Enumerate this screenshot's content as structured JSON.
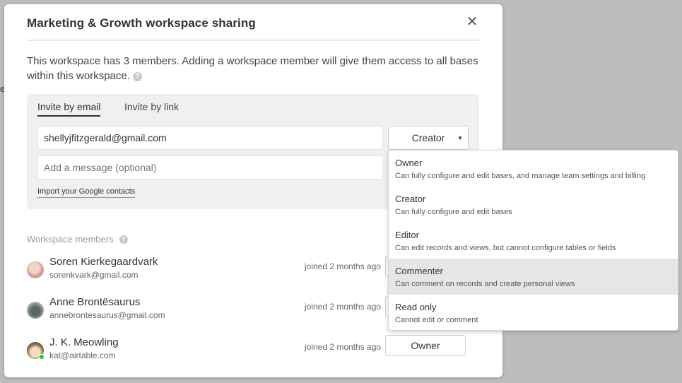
{
  "background_fragment": "es",
  "modal": {
    "title": "Marketing & Growth workspace sharing",
    "close_glyph": "✕",
    "description": "This workspace has 3 members. Adding a workspace member will give them access to all bases within this workspace.",
    "help_glyph": "?"
  },
  "invite": {
    "tabs": [
      {
        "label": "Invite by email",
        "active": true
      },
      {
        "label": "Invite by link",
        "active": false
      }
    ],
    "email_value": "shellyjfitzgerald@gmail.com",
    "message_placeholder": "Add a message (optional)",
    "selected_role": "Creator",
    "caret_glyph": "▼",
    "import_label": "Import your Google contacts"
  },
  "members_section": {
    "heading": "Workspace members",
    "members": [
      {
        "name": "Soren Kierkegaardvark",
        "email": "sorenkvark@gmail.com",
        "joined": "joined 2 months ago",
        "role": "",
        "online": false,
        "avatar_color": "#d9b8a8"
      },
      {
        "name": "Anne Brontësaurus",
        "email": "annebrontesaurus@gmail.com",
        "joined": "joined 2 months ago",
        "role": "",
        "online": false,
        "avatar_color": "#7d8a86"
      },
      {
        "name": "J. K. Meowling",
        "email": "kat@airtable.com",
        "joined": "joined 2 months ago",
        "role": "Owner",
        "online": true,
        "avatar_color": "#c9a87a"
      }
    ]
  },
  "role_menu": {
    "hovered_index": 3,
    "options": [
      {
        "title": "Owner",
        "description": "Can fully configure and edit bases, and manage team settings and billing"
      },
      {
        "title": "Creator",
        "description": "Can fully configure and edit bases"
      },
      {
        "title": "Editor",
        "description": "Can edit records and views, but cannot configure tables or fields"
      },
      {
        "title": "Commenter",
        "description": "Can comment on records and create personal views"
      },
      {
        "title": "Read only",
        "description": "Cannot edit or comment"
      }
    ]
  },
  "colors": {
    "overlay": "#bdbdbd",
    "panel": "#f0f0f0",
    "hover": "#e6e6e6",
    "online": "#20c933"
  }
}
